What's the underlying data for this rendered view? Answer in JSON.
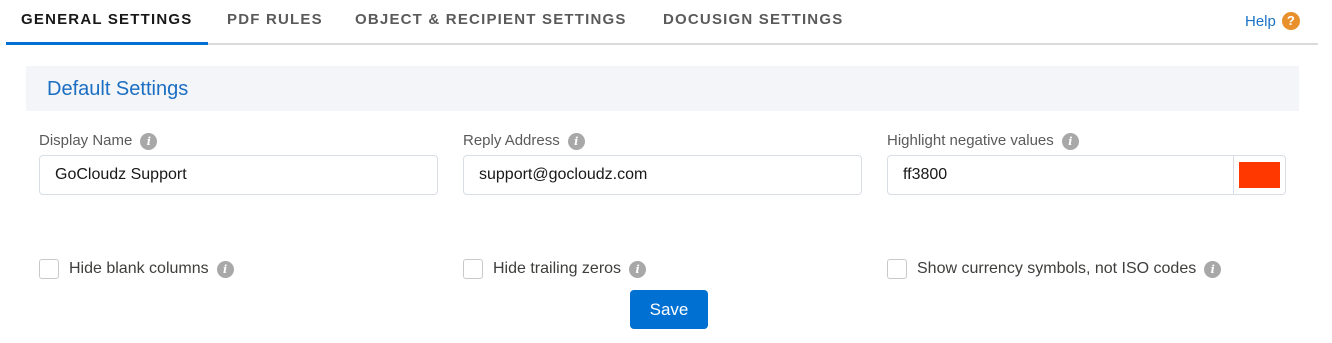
{
  "tabs": [
    {
      "label": "GENERAL SETTINGS",
      "active": true
    },
    {
      "label": "PDF RULES",
      "active": false
    },
    {
      "label": "OBJECT & RECIPIENT SETTINGS",
      "active": false
    },
    {
      "label": "DOCUSIGN SETTINGS",
      "active": false
    }
  ],
  "help": {
    "label": "Help",
    "icon": "question-icon",
    "icon_glyph": "?",
    "icon_color": "#e8912c"
  },
  "section": {
    "title": "Default Settings"
  },
  "info_glyph": "i",
  "fields": {
    "display_name": {
      "label": "Display Name",
      "value": "GoCloudz Support"
    },
    "reply_address": {
      "label": "Reply Address",
      "value": "support@gocloudz.com"
    },
    "highlight_negative": {
      "label": "Highlight negative values",
      "value": "ff3800",
      "swatch_color": "#ff3800"
    }
  },
  "checkboxes": [
    {
      "label": "Hide blank columns",
      "checked": false
    },
    {
      "label": "Hide trailing zeros",
      "checked": false
    },
    {
      "label": "Show currency symbols, not ISO codes",
      "checked": false
    }
  ],
  "save_label": "Save",
  "colors": {
    "accent": "#0070d2",
    "title": "#1b6ec2",
    "section_bg": "#f3f5f9"
  }
}
